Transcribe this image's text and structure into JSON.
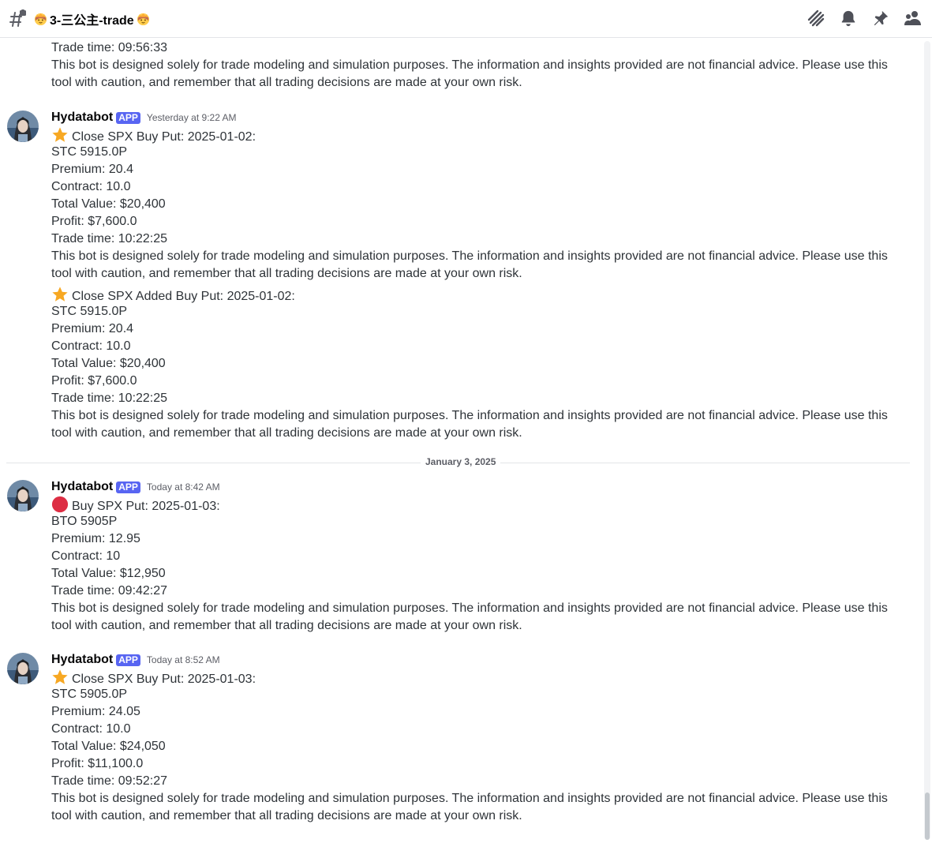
{
  "header": {
    "channel_name": "3-三公主-trade",
    "icons": [
      "threads-icon",
      "bell-icon",
      "pin-icon",
      "members-icon"
    ]
  },
  "messages": {
    "prev_tail": {
      "trade_time": "Trade time: 09:56:33",
      "disclaimer_1": "This bot is designed solely for trade modeling and simulation purposes. The information and insights provided are not financial advice. Please use this",
      "disclaimer_2": "tool with caution, and remember that all trading decisions are made at your own risk."
    },
    "m1": {
      "author": "Hydatabot",
      "badge": "APP",
      "time": "Yesterday at 9:22 AM",
      "a": {
        "title": "Close SPX Buy Put: 2025-01-02:",
        "l1": "STC 5915.0P",
        "l2": "Premium: 20.4",
        "l3": "Contract: 10.0",
        "l4": "Total Value: $20,400",
        "l5": "Profit: $7,600.0",
        "l6": "Trade time: 10:22:25",
        "d1": "This bot is designed solely for trade modeling and simulation purposes. The information and insights provided are not financial advice. Please use this",
        "d2": "tool with caution, and remember that all trading decisions are made at your own risk."
      },
      "b": {
        "title": "Close SPX Added Buy Put: 2025-01-02:",
        "l1": "STC 5915.0P",
        "l2": "Premium: 20.4",
        "l3": "Contract: 10.0",
        "l4": "Total Value: $20,400",
        "l5": "Profit: $7,600.0",
        "l6": "Trade time: 10:22:25",
        "d1": "This bot is designed solely for trade modeling and simulation purposes. The information and insights provided are not financial advice. Please use this",
        "d2": "tool with caution, and remember that all trading decisions are made at your own risk."
      }
    },
    "date_divider": "January 3, 2025",
    "m2": {
      "author": "Hydatabot",
      "badge": "APP",
      "time": "Today at 8:42 AM",
      "title": "Buy SPX Put: 2025-01-03:",
      "l1": "BTO 5905P",
      "l2": "Premium: 12.95",
      "l3": "Contract: 10",
      "l4": "Total Value: $12,950",
      "l5": "Trade time: 09:42:27",
      "d1": "This bot is designed solely for trade modeling and simulation purposes. The information and insights provided are not financial advice. Please use this",
      "d2": "tool with caution, and remember that all trading decisions are made at your own risk."
    },
    "m3": {
      "author": "Hydatabot",
      "badge": "APP",
      "time": "Today at 8:52 AM",
      "title": "Close SPX Buy Put: 2025-01-03:",
      "l1": "STC 5905.0P",
      "l2": "Premium: 24.05",
      "l3": "Contract: 10.0",
      "l4": "Total Value: $24,050",
      "l5": "Profit: $11,100.0",
      "l6": "Trade time: 09:52:27",
      "d1": "This bot is designed solely for trade modeling and simulation purposes. The information and insights provided are not financial advice. Please use this",
      "d2": "tool with caution, and remember that all trading decisions are made at your own risk."
    }
  },
  "colors": {
    "app_badge": "#5865f2",
    "star": "#f7a823",
    "red_circle": "#dd2e44"
  }
}
